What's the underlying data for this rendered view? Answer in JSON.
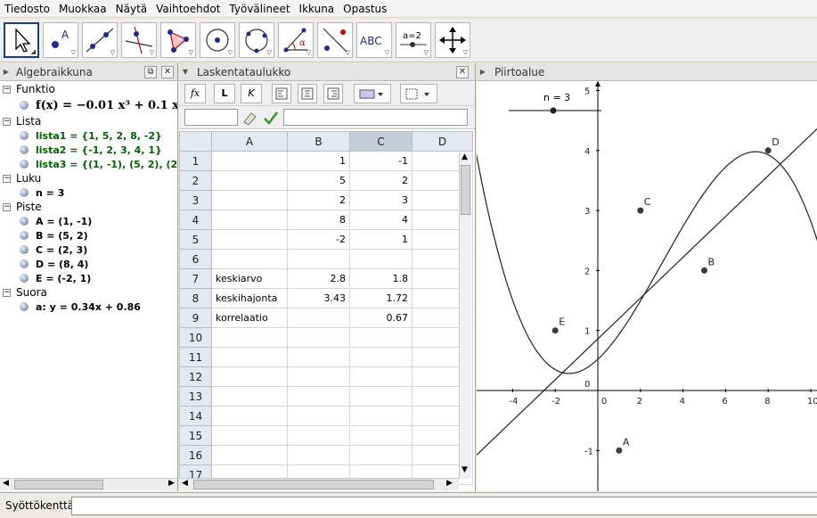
{
  "menu": [
    "Tiedosto",
    "Muokkaa",
    "Näytä",
    "Vaihtoehdot",
    "Työvälineet",
    "Ikkuna",
    "Opastus"
  ],
  "toolbar": {
    "tools": [
      "move-tool",
      "point-tool",
      "line-tool",
      "perpendicular-tool",
      "polygon-tool",
      "circle-tool",
      "conic-tool",
      "angle-tool",
      "reflect-tool",
      "text-tool",
      "slider-tool",
      "move-view-tool"
    ],
    "text_tool_label": "ABC",
    "slider_tool_label": "a=2"
  },
  "algebra": {
    "title": "Algebraikkuna",
    "categories": [
      {
        "name": "Funktio",
        "items": [
          "f(x) = −0.01 x³ + 0.1 x²"
        ]
      },
      {
        "name": "Lista",
        "items": [
          "lista1 = {1, 5, 2, 8, -2}",
          "lista2 = {-1, 2, 3, 4, 1}",
          "lista3 = {(1, -1), (5, 2), (2, 3),"
        ]
      },
      {
        "name": "Luku",
        "items": [
          "n = 3"
        ]
      },
      {
        "name": "Piste",
        "items": [
          "A = (1, -1)",
          "B = (5, 2)",
          "C = (2, 3)",
          "D = (8, 4)",
          "E = (-2, 1)"
        ]
      },
      {
        "name": "Suora",
        "items": [
          "a: y = 0.34x + 0.86"
        ]
      }
    ]
  },
  "spreadsheet": {
    "title": "Laskentataulukko",
    "buttons": {
      "fx": "fx",
      "bold": "L",
      "italic": "K"
    },
    "columns": [
      "A",
      "B",
      "C",
      "D"
    ],
    "rows": [
      [
        "",
        "1",
        "-1",
        ""
      ],
      [
        "",
        "5",
        "2",
        ""
      ],
      [
        "",
        "2",
        "3",
        ""
      ],
      [
        "",
        "8",
        "4",
        ""
      ],
      [
        "",
        "-2",
        "1",
        ""
      ],
      [
        "",
        "",
        "",
        ""
      ],
      [
        "keskiarvo",
        "2.8",
        "1.8",
        ""
      ],
      [
        "keskihajonta",
        "3.43",
        "1.72",
        ""
      ],
      [
        "korrelaatio",
        "",
        "0.67",
        ""
      ],
      [
        "",
        "",
        "",
        ""
      ],
      [
        "",
        "",
        "",
        ""
      ],
      [
        "",
        "",
        "",
        ""
      ],
      [
        "",
        "",
        "",
        ""
      ],
      [
        "",
        "",
        "",
        ""
      ],
      [
        "",
        "",
        "",
        ""
      ],
      [
        "",
        "",
        "",
        ""
      ],
      [
        "",
        "",
        "",
        ""
      ]
    ]
  },
  "graphics": {
    "title": "Piirtoalue",
    "slider_label": "n = 3",
    "points": [
      {
        "name": "A",
        "x": 1,
        "y": -1
      },
      {
        "name": "B",
        "x": 5,
        "y": 2
      },
      {
        "name": "C",
        "x": 2,
        "y": 3
      },
      {
        "name": "D",
        "x": 8,
        "y": 4
      },
      {
        "name": "E",
        "x": -2,
        "y": 1
      }
    ],
    "x_ticks": [
      "-4",
      "-2",
      "0",
      "2",
      "4",
      "6",
      "8",
      "10"
    ],
    "y_ticks": [
      "-1",
      "0",
      "1",
      "2",
      "3",
      "4",
      "5"
    ]
  },
  "inputbar": {
    "label": "Syöttökenttä:"
  }
}
